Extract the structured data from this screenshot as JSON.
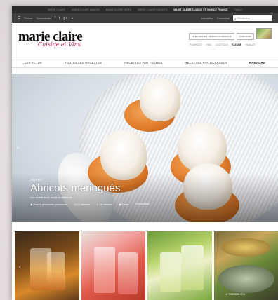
{
  "network_bar": {
    "items": [
      "Marie Claire",
      "Marie Claire Maison",
      "Marie Claire Idées",
      "Marie Claire Enfants",
      "Marie Claire Cuisine et Vins de France",
      "Famili"
    ],
    "active_index": 4
  },
  "social_bar": {
    "menu_label": "Fermer",
    "connect_label": "Commander",
    "inscription": "Inscription",
    "connexion": "Connexion",
    "search_placeholder": "Rechercher"
  },
  "brand": {
    "logo_main": "marie claire",
    "logo_sub": "Cuisine et Vins",
    "logo_tag": "de France",
    "pill_1": "Télécharger l'édition numérique",
    "pill_2": "S'abonner",
    "subnav": [
      "Pourquoi",
      "Vins",
      "Cocktails",
      "Cuisine",
      "Famille"
    ],
    "subnav_current_index": 3
  },
  "mainnav": {
    "items": [
      "Les actus",
      "Toutes les recettes",
      "Recettes par thèmes",
      "Recettes par occasion",
      "Ramadan"
    ],
    "strong_index": 4
  },
  "hero": {
    "kicker": "Dessert",
    "title": "Abricots meringués",
    "description": "Une recette toute simple et délicieuse",
    "meta": [
      "Pour 6 personnes personnes",
      "10 minutes",
      "15 minutes",
      "Facile",
      "Abordable"
    ],
    "arrow_left": "‹",
    "arrow_right": "›"
  },
  "thumbs": {
    "arrow_left": "‹",
    "caption_4": "Le poisson cru"
  }
}
